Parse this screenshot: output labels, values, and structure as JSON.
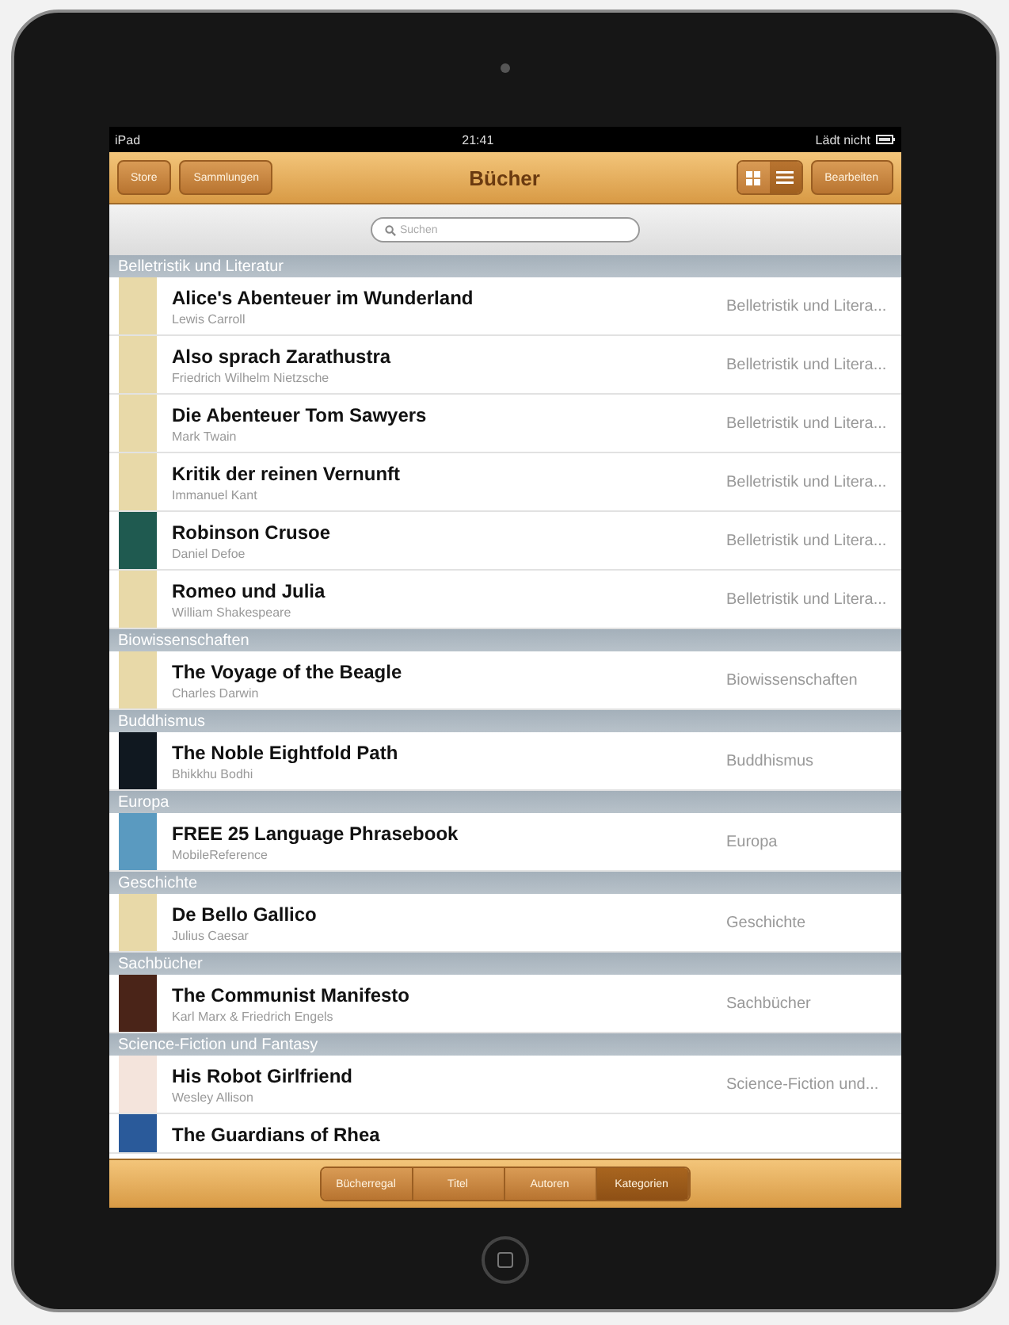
{
  "status_bar": {
    "device": "iPad",
    "time": "21:41",
    "battery": "Lädt nicht"
  },
  "nav_bar": {
    "left_buttons": [
      "Store",
      "Sammlungen"
    ],
    "title": "Bücher",
    "view_toggle": [
      {
        "kind": "grid",
        "selected": false
      },
      {
        "kind": "list",
        "selected": true
      }
    ],
    "right_button": "Bearbeiten"
  },
  "search": {
    "placeholder": "Suchen"
  },
  "sections": [
    {
      "header": "Belletristik und Literatur",
      "books": [
        {
          "title": "Alice's Abenteuer im Wunderland",
          "author": "Lewis Carroll",
          "category": "Belletristik und Litera...",
          "color": "#e8d9a8"
        },
        {
          "title": "Also sprach Zarathustra",
          "author": "Friedrich Wilhelm Nietzsche",
          "category": "Belletristik und Litera...",
          "color": "#e8d9a8"
        },
        {
          "title": "Die Abenteuer Tom Sawyers",
          "author": "Mark Twain",
          "category": "Belletristik und Litera...",
          "color": "#e8d9a8"
        },
        {
          "title": "Kritik der reinen Vernunft",
          "author": "Immanuel Kant",
          "category": "Belletristik und Litera...",
          "color": "#e8d9a8"
        },
        {
          "title": "Robinson Crusoe",
          "author": "Daniel Defoe",
          "category": "Belletristik und Litera...",
          "color": "#1f5a50"
        },
        {
          "title": "Romeo und Julia",
          "author": "William Shakespeare",
          "category": "Belletristik und Litera...",
          "color": "#e8d9a8"
        }
      ]
    },
    {
      "header": "Biowissenschaften",
      "books": [
        {
          "title": "The Voyage of the Beagle",
          "author": "Charles Darwin",
          "category": "Biowissenschaften",
          "color": "#e8d9a8"
        }
      ]
    },
    {
      "header": "Buddhismus",
      "books": [
        {
          "title": "The Noble Eightfold Path",
          "author": "Bhikkhu Bodhi",
          "category": "Buddhismus",
          "color": "#101820"
        }
      ]
    },
    {
      "header": "Europa",
      "books": [
        {
          "title": "FREE 25 Language Phrasebook",
          "author": "MobileReference",
          "category": "Europa",
          "color": "#5a9ac0"
        }
      ]
    },
    {
      "header": "Geschichte",
      "books": [
        {
          "title": "De Bello Gallico",
          "author": "Julius Caesar",
          "category": "Geschichte",
          "color": "#e8d9a8"
        }
      ]
    },
    {
      "header": "Sachbücher",
      "books": [
        {
          "title": "The Communist Manifesto",
          "author": "Karl Marx & Friedrich Engels",
          "category": "Sachbücher",
          "color": "#4a2418"
        }
      ]
    },
    {
      "header": "Science-Fiction und Fantasy",
      "books": [
        {
          "title": "His Robot Girlfriend",
          "author": "Wesley Allison",
          "category": "Science-Fiction und...",
          "color": "#f4e4dc"
        },
        {
          "title": "The Guardians of Rhea",
          "color": "#2a5a9a"
        }
      ]
    }
  ],
  "toolbar": {
    "segments": [
      {
        "label": "Bücherregal",
        "selected": false
      },
      {
        "label": "Titel",
        "selected": false
      },
      {
        "label": "Autoren",
        "selected": false
      },
      {
        "label": "Kategorien",
        "selected": true
      }
    ]
  }
}
